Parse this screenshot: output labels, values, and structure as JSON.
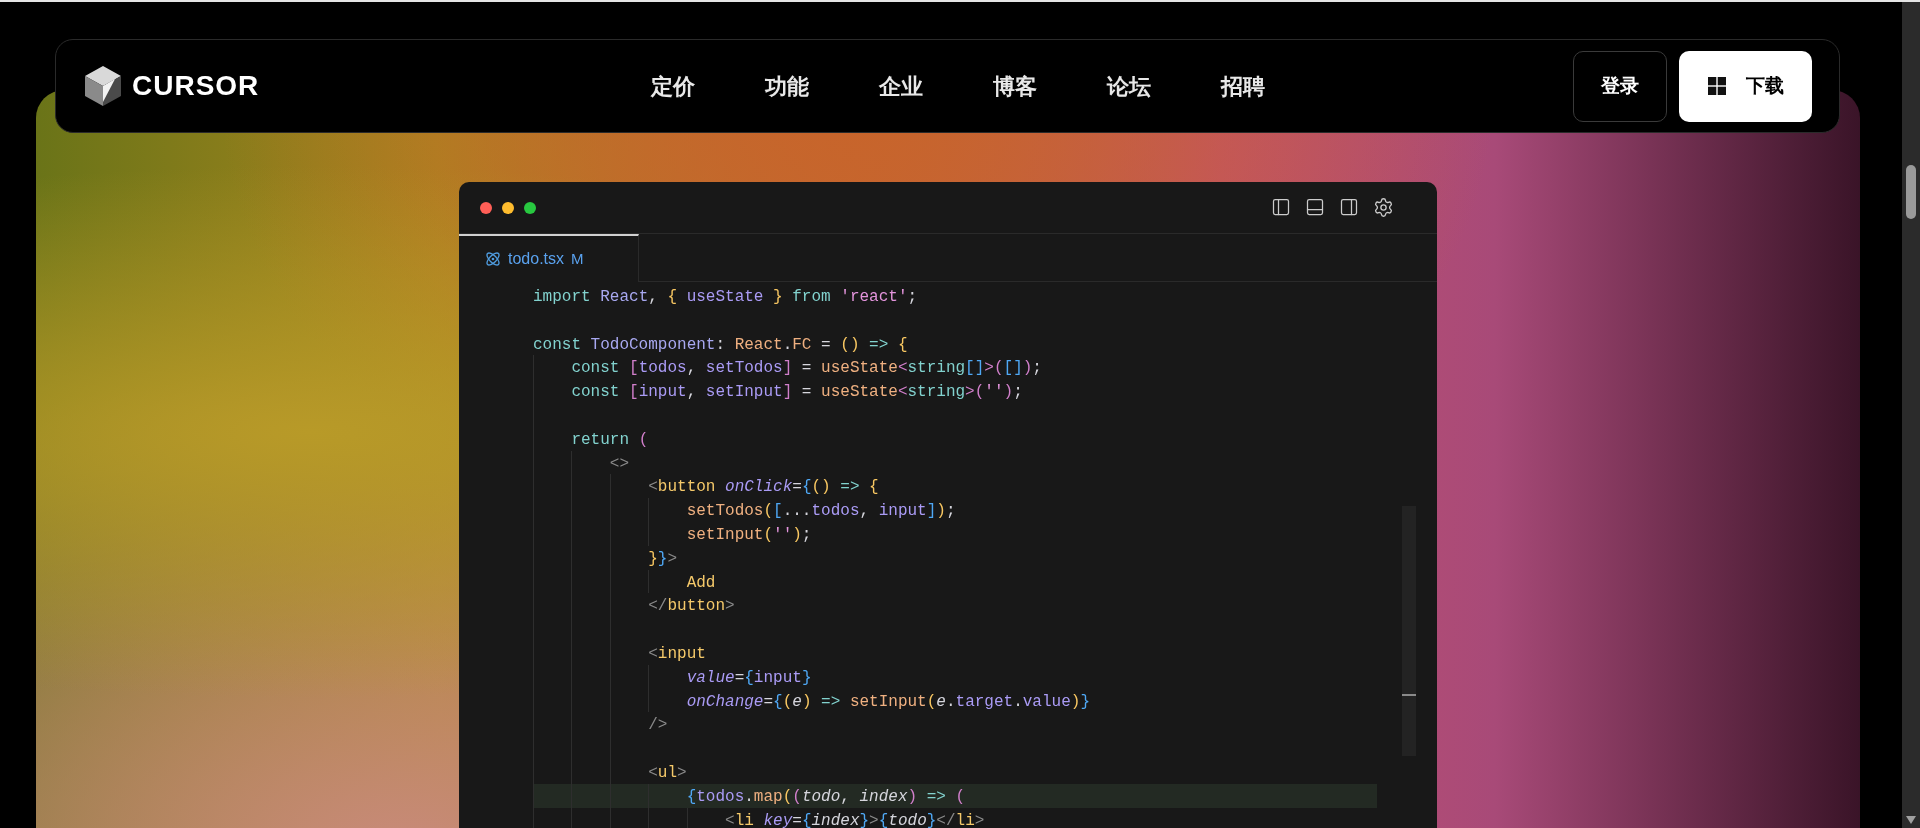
{
  "nav": {
    "logo": "CURSOR",
    "links": [
      "定价",
      "功能",
      "企业",
      "博客",
      "论坛",
      "招聘"
    ],
    "login": "登录",
    "download": "下载"
  },
  "editor": {
    "tabs": [
      {
        "label": "todo.tsx",
        "status": "M",
        "selected": true
      }
    ],
    "lines": [
      {
        "kind": "code",
        "highlighted": false,
        "tokens": [
          {
            "text": "import ",
            "kind": "kw"
          },
          {
            "text": "React",
            "kind": "cls"
          },
          {
            "text": ", ",
            "kind": "p"
          },
          {
            "text": "{",
            "kind": "b1"
          },
          {
            "text": " useState ",
            "kind": "var"
          },
          {
            "text": "} ",
            "kind": "b1"
          },
          {
            "text": "from ",
            "kind": "kw"
          },
          {
            "text": "'react'",
            "kind": "str"
          },
          {
            "text": ";",
            "kind": "p"
          }
        ]
      },
      {
        "kind": "blank"
      },
      {
        "kind": "code",
        "highlighted": false,
        "tokens": [
          {
            "text": "const ",
            "kind": "kw"
          },
          {
            "text": "TodoComponent",
            "kind": "cls"
          },
          {
            "text": ": ",
            "kind": "p"
          },
          {
            "text": "React",
            "kind": "fn"
          },
          {
            "text": ".",
            "kind": "p"
          },
          {
            "text": "FC",
            "kind": "fn"
          },
          {
            "text": " = ",
            "kind": "p"
          },
          {
            "text": "() ",
            "kind": "b1"
          },
          {
            "text": "=> ",
            "kind": "op"
          },
          {
            "text": "{",
            "kind": "b1"
          }
        ]
      },
      {
        "kind": "code",
        "highlighted": false,
        "tokens": [
          {
            "text": "    const ",
            "kind": "kw"
          },
          {
            "text": "[",
            "kind": "b2"
          },
          {
            "text": "todos",
            "kind": "var"
          },
          {
            "text": ", ",
            "kind": "p"
          },
          {
            "text": "setTodos",
            "kind": "var"
          },
          {
            "text": "]",
            "kind": "b2"
          },
          {
            "text": " = ",
            "kind": "p"
          },
          {
            "text": "useState",
            "kind": "fn"
          },
          {
            "text": "<",
            "kind": "b2"
          },
          {
            "text": "string",
            "kind": "type"
          },
          {
            "text": "[]",
            "kind": "b3"
          },
          {
            "text": ">",
            "kind": "b2"
          },
          {
            "text": "(",
            "kind": "b2"
          },
          {
            "text": "[]",
            "kind": "b3"
          },
          {
            "text": ")",
            "kind": "b2"
          },
          {
            "text": ";",
            "kind": "p"
          }
        ]
      },
      {
        "kind": "code",
        "highlighted": false,
        "tokens": [
          {
            "text": "    const ",
            "kind": "kw"
          },
          {
            "text": "[",
            "kind": "b2"
          },
          {
            "text": "input",
            "kind": "var"
          },
          {
            "text": ", ",
            "kind": "p"
          },
          {
            "text": "setInput",
            "kind": "var"
          },
          {
            "text": "]",
            "kind": "b2"
          },
          {
            "text": " = ",
            "kind": "p"
          },
          {
            "text": "useState",
            "kind": "fn"
          },
          {
            "text": "<",
            "kind": "b2"
          },
          {
            "text": "string",
            "kind": "type"
          },
          {
            "text": ">",
            "kind": "b2"
          },
          {
            "text": "(",
            "kind": "b2"
          },
          {
            "text": "''",
            "kind": "str"
          },
          {
            "text": ")",
            "kind": "b2"
          },
          {
            "text": ";",
            "kind": "p"
          }
        ]
      },
      {
        "kind": "blank"
      },
      {
        "kind": "code",
        "highlighted": false,
        "tokens": [
          {
            "text": "    return ",
            "kind": "kw"
          },
          {
            "text": "(",
            "kind": "b2"
          }
        ]
      },
      {
        "kind": "code",
        "highlighted": false,
        "tokens": [
          {
            "text": "        <>",
            "kind": "tagp"
          }
        ]
      },
      {
        "kind": "code",
        "highlighted": false,
        "tokens": [
          {
            "text": "            <",
            "kind": "tagp"
          },
          {
            "text": "button ",
            "kind": "tag"
          },
          {
            "text": "onClick",
            "kind": "attr"
          },
          {
            "text": "=",
            "kind": "p"
          },
          {
            "text": "{",
            "kind": "b3"
          },
          {
            "text": "() ",
            "kind": "b1"
          },
          {
            "text": "=> ",
            "kind": "op"
          },
          {
            "text": "{",
            "kind": "b1"
          }
        ]
      },
      {
        "kind": "code",
        "highlighted": false,
        "tokens": [
          {
            "text": "                setTodos",
            "kind": "fn"
          },
          {
            "text": "(",
            "kind": "b1"
          },
          {
            "text": "[",
            "kind": "b3"
          },
          {
            "text": "...",
            "kind": "p"
          },
          {
            "text": "todos",
            "kind": "var"
          },
          {
            "text": ", ",
            "kind": "p"
          },
          {
            "text": "input",
            "kind": "var"
          },
          {
            "text": "]",
            "kind": "b3"
          },
          {
            "text": ")",
            "kind": "b1"
          },
          {
            "text": ";",
            "kind": "p"
          }
        ]
      },
      {
        "kind": "code",
        "highlighted": false,
        "tokens": [
          {
            "text": "                setInput",
            "kind": "fn"
          },
          {
            "text": "(",
            "kind": "b1"
          },
          {
            "text": "''",
            "kind": "str"
          },
          {
            "text": ")",
            "kind": "b1"
          },
          {
            "text": ";",
            "kind": "p"
          }
        ]
      },
      {
        "kind": "code",
        "highlighted": false,
        "tokens": [
          {
            "text": "            }",
            "kind": "b1"
          },
          {
            "text": "}",
            "kind": "b3"
          },
          {
            "text": ">",
            "kind": "tagp"
          }
        ]
      },
      {
        "kind": "code",
        "highlighted": false,
        "tokens": [
          {
            "text": "                Add",
            "kind": "text"
          }
        ]
      },
      {
        "kind": "code",
        "highlighted": false,
        "tokens": [
          {
            "text": "            </",
            "kind": "tagp"
          },
          {
            "text": "button",
            "kind": "tag"
          },
          {
            "text": ">",
            "kind": "tagp"
          }
        ]
      },
      {
        "kind": "blank"
      },
      {
        "kind": "code",
        "highlighted": false,
        "tokens": [
          {
            "text": "            <",
            "kind": "tagp"
          },
          {
            "text": "input",
            "kind": "tag"
          }
        ]
      },
      {
        "kind": "code",
        "highlighted": false,
        "tokens": [
          {
            "text": "                value",
            "kind": "attr"
          },
          {
            "text": "=",
            "kind": "p"
          },
          {
            "text": "{",
            "kind": "b3"
          },
          {
            "text": "input",
            "kind": "var"
          },
          {
            "text": "}",
            "kind": "b3"
          }
        ]
      },
      {
        "kind": "code",
        "highlighted": false,
        "tokens": [
          {
            "text": "                onChange",
            "kind": "attr"
          },
          {
            "text": "=",
            "kind": "p"
          },
          {
            "text": "{",
            "kind": "b3"
          },
          {
            "text": "(",
            "kind": "b1"
          },
          {
            "text": "e",
            "kind": "param"
          },
          {
            "text": ") ",
            "kind": "b1"
          },
          {
            "text": "=> ",
            "kind": "op"
          },
          {
            "text": "setInput",
            "kind": "fn"
          },
          {
            "text": "(",
            "kind": "b1"
          },
          {
            "text": "e",
            "kind": "param"
          },
          {
            "text": ".",
            "kind": "p"
          },
          {
            "text": "target",
            "kind": "var"
          },
          {
            "text": ".",
            "kind": "p"
          },
          {
            "text": "value",
            "kind": "var"
          },
          {
            "text": ")",
            "kind": "b1"
          },
          {
            "text": "}",
            "kind": "b3"
          }
        ]
      },
      {
        "kind": "code",
        "highlighted": false,
        "tokens": [
          {
            "text": "            />",
            "kind": "tagp"
          }
        ]
      },
      {
        "kind": "blank"
      },
      {
        "kind": "code",
        "highlighted": false,
        "tokens": [
          {
            "text": "            <",
            "kind": "tagp"
          },
          {
            "text": "ul",
            "kind": "tag"
          },
          {
            "text": ">",
            "kind": "tagp"
          }
        ]
      },
      {
        "kind": "code",
        "highlighted": true,
        "tokens": [
          {
            "text": "                {",
            "kind": "b3"
          },
          {
            "text": "todos",
            "kind": "var"
          },
          {
            "text": ".",
            "kind": "p"
          },
          {
            "text": "map",
            "kind": "fn"
          },
          {
            "text": "(",
            "kind": "b1"
          },
          {
            "text": "(",
            "kind": "b2"
          },
          {
            "text": "todo",
            "kind": "param"
          },
          {
            "text": ", ",
            "kind": "p"
          },
          {
            "text": "index",
            "kind": "param"
          },
          {
            "text": ") ",
            "kind": "b2"
          },
          {
            "text": "=> ",
            "kind": "op"
          },
          {
            "text": "(",
            "kind": "b2"
          }
        ]
      },
      {
        "kind": "code",
        "highlighted": false,
        "tokens": [
          {
            "text": "                    <",
            "kind": "tagp"
          },
          {
            "text": "li ",
            "kind": "tag"
          },
          {
            "text": "key",
            "kind": "attr"
          },
          {
            "text": "=",
            "kind": "p"
          },
          {
            "text": "{",
            "kind": "b3"
          },
          {
            "text": "index",
            "kind": "param"
          },
          {
            "text": "}",
            "kind": "b3"
          },
          {
            "text": ">",
            "kind": "tagp"
          },
          {
            "text": "{",
            "kind": "b3"
          },
          {
            "text": "todo",
            "kind": "param"
          },
          {
            "text": "}",
            "kind": "b3"
          },
          {
            "text": "</",
            "kind": "tagp"
          },
          {
            "text": "li",
            "kind": "tag"
          },
          {
            "text": ">",
            "kind": "tagp"
          }
        ]
      }
    ]
  }
}
